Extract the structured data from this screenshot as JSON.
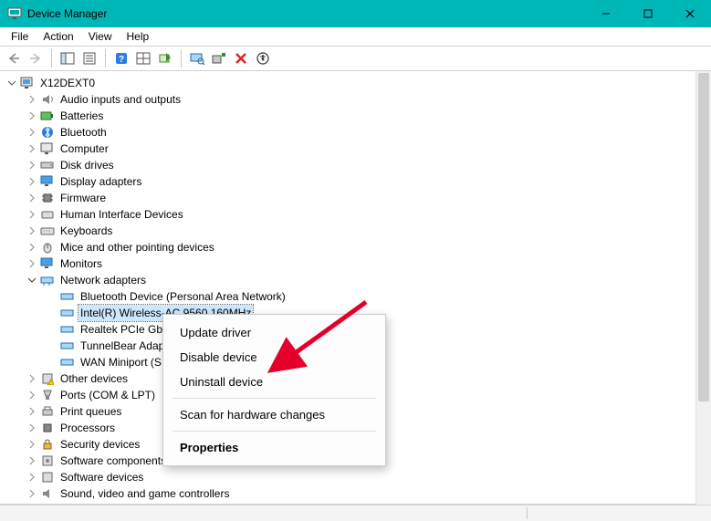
{
  "window": {
    "title": "Device Manager"
  },
  "menu": {
    "file": "File",
    "action": "Action",
    "view": "View",
    "help": "Help"
  },
  "tree": {
    "root": "X12DEXT0",
    "categories": [
      "Audio inputs and outputs",
      "Batteries",
      "Bluetooth",
      "Computer",
      "Disk drives",
      "Display adapters",
      "Firmware",
      "Human Interface Devices",
      "Keyboards",
      "Mice and other pointing devices",
      "Monitors",
      "Network adapters",
      "Other devices",
      "Ports (COM & LPT)",
      "Print queues",
      "Processors",
      "Security devices",
      "Software components",
      "Software devices",
      "Sound, video and game controllers"
    ],
    "network_adapters": {
      "children": [
        "Bluetooth Device (Personal Area Network)",
        "Intel(R) Wireless-AC 9560 160MHz",
        "Realtek PCIe GbE",
        "TunnelBear Adap",
        "WAN Miniport (S"
      ],
      "selected_index": 1
    }
  },
  "context_menu": {
    "update": "Update driver",
    "disable": "Disable device",
    "uninstall": "Uninstall device",
    "scan": "Scan for hardware changes",
    "properties": "Properties"
  }
}
